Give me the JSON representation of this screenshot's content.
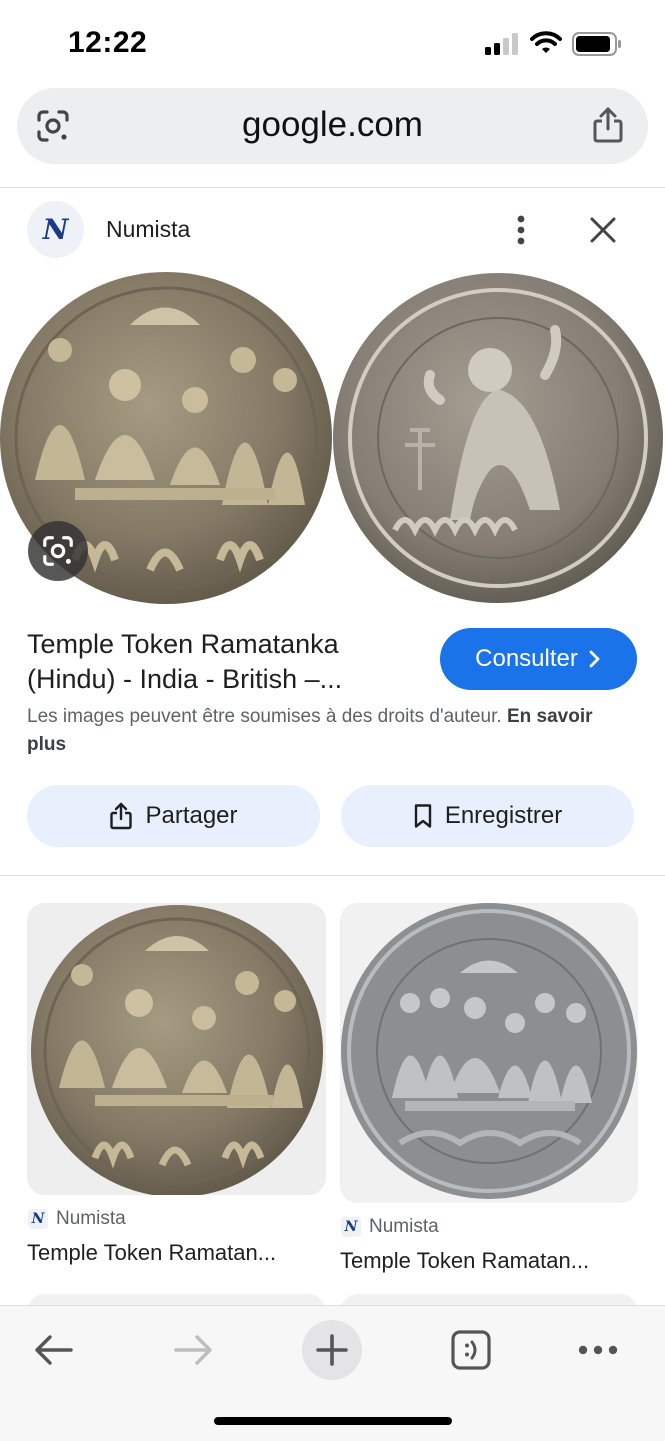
{
  "status_bar": {
    "time": "12:22"
  },
  "url_bar": {
    "url": "google.com"
  },
  "source": {
    "logo_letter": "N",
    "name": "Numista"
  },
  "result": {
    "title": "Temple Token Ramatanka (Hindu) - India - British –...",
    "visit_label": "Consulter",
    "copyright_text": "Les images peuvent être soumises à des droits d'auteur.",
    "learn_more": "En savoir plus"
  },
  "actions": {
    "share_label": "Partager",
    "save_label": "Enregistrer"
  },
  "grid": [
    {
      "source": "Numista",
      "title": "Temple Token Ramatan..."
    },
    {
      "source": "Numista",
      "title": "Temple Token Ramatan..."
    }
  ],
  "colors": {
    "accent": "#1a73e8",
    "action_bg": "#e8f0fe",
    "url_bar_bg": "#eceef0"
  },
  "icons": {
    "lens": "google-lens-icon",
    "share": "share-icon",
    "more": "more-vertical-icon",
    "close": "close-icon",
    "bookmark": "bookmark-icon",
    "chevron": "chevron-right-icon",
    "back": "back-arrow-icon",
    "forward": "forward-arrow-icon",
    "new_tab": "plus-icon",
    "tabs": "tab-switcher-icon",
    "menu": "more-horizontal-icon"
  }
}
